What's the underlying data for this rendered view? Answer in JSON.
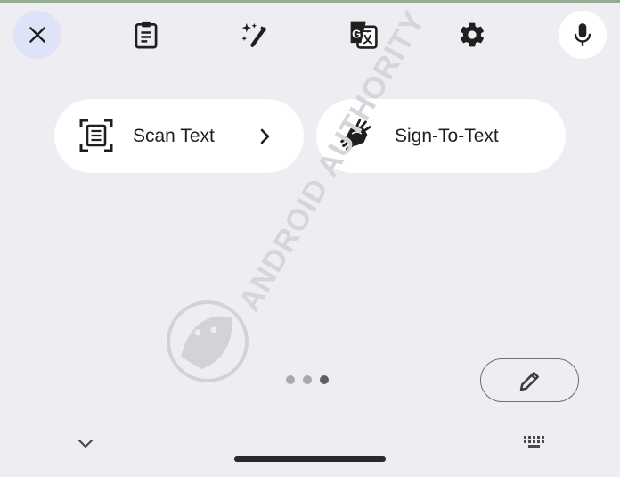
{
  "toolbar": {
    "close_icon": "close-icon",
    "clipboard_icon": "clipboard-icon",
    "magic_icon": "magic-wand-icon",
    "translate_icon": "translate-icon",
    "settings_icon": "gear-icon",
    "mic_icon": "mic-icon"
  },
  "actions": {
    "scan_text": {
      "label": "Scan Text",
      "icon": "scan-text-icon"
    },
    "sign_to_text": {
      "label": "Sign-To-Text",
      "icon": "sign-language-icon"
    }
  },
  "pager": {
    "count": 3,
    "active_index": 2
  },
  "bottom": {
    "edit_icon": "pencil-icon",
    "collapse_icon": "chevron-down-icon",
    "keyboard_icon": "keyboard-icon"
  },
  "watermark": {
    "text": "ANDROID AUTHORITY"
  },
  "colors": {
    "background": "#eeedf2",
    "close_bg": "#dfe3f7",
    "pill_bg": "#ffffff"
  }
}
